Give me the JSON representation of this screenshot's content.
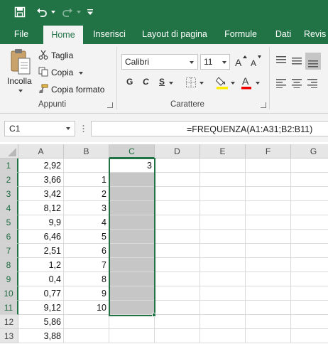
{
  "colors": {
    "brand": "#217346",
    "selection_fill": "#c6c6c6"
  },
  "quick_access": {
    "save_icon": "save-icon",
    "undo_icon": "undo-icon",
    "redo_icon": "redo-icon",
    "customize_icon": "customize-icon"
  },
  "tabs": [
    "File",
    "Home",
    "Inserisci",
    "Layout di pagina",
    "Formule",
    "Dati",
    "Revis"
  ],
  "active_tab": "Home",
  "ribbon": {
    "clipboard": {
      "paste_label": "Incolla",
      "cut_label": "Taglia",
      "copy_label": "Copia",
      "format_painter_label": "Copia formato",
      "group_label": "Appunti"
    },
    "font": {
      "font_name": "Calibri",
      "font_size": "11",
      "bold": "G",
      "italic": "C",
      "underline": "S",
      "group_label": "Carattere"
    }
  },
  "formula_bar": {
    "name_box": "C1",
    "fx_label": "fx",
    "formula": "=FREQUENZA(A1:A31;B2:B11)"
  },
  "sheet": {
    "columns": [
      "A",
      "B",
      "C",
      "D",
      "E",
      "F",
      "G"
    ],
    "selected_column": "C",
    "rows": [
      {
        "num": "1",
        "a": "2,92",
        "b": "",
        "c": "3"
      },
      {
        "num": "2",
        "a": "3,66",
        "b": "1",
        "c": ""
      },
      {
        "num": "3",
        "a": "3,42",
        "b": "2",
        "c": ""
      },
      {
        "num": "4",
        "a": "8,12",
        "b": "3",
        "c": ""
      },
      {
        "num": "5",
        "a": "9,9",
        "b": "4",
        "c": ""
      },
      {
        "num": "6",
        "a": "6,46",
        "b": "5",
        "c": ""
      },
      {
        "num": "7",
        "a": "2,51",
        "b": "6",
        "c": ""
      },
      {
        "num": "8",
        "a": "1,2",
        "b": "7",
        "c": ""
      },
      {
        "num": "9",
        "a": "0,4",
        "b": "8",
        "c": ""
      },
      {
        "num": "10",
        "a": "0,77",
        "b": "9",
        "c": ""
      },
      {
        "num": "11",
        "a": "9,12",
        "b": "10",
        "c": ""
      },
      {
        "num": "12",
        "a": "5,86",
        "b": "",
        "c": ""
      },
      {
        "num": "13",
        "a": "3,88",
        "b": "",
        "c": ""
      }
    ]
  }
}
